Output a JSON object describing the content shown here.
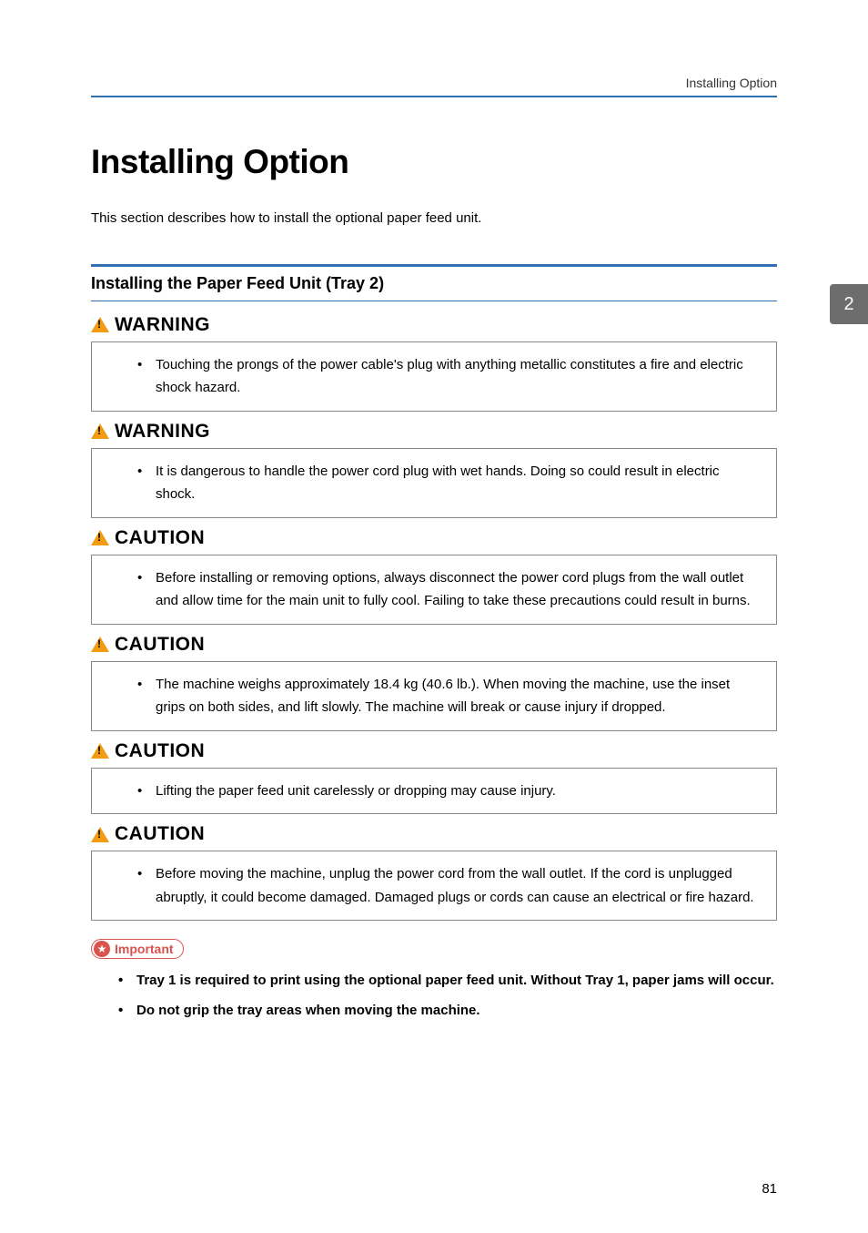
{
  "header": {
    "running_title": "Installing Option"
  },
  "section_tab": "2",
  "title": "Installing Option",
  "intro": "This section describes how to install the optional paper feed unit.",
  "subsection": "Installing the Paper Feed Unit (Tray 2)",
  "labels": {
    "warning": "WARNING",
    "caution": "CAUTION",
    "important": "Important"
  },
  "alerts": [
    {
      "level": "warning",
      "text": "Touching the prongs of the power cable's plug with anything metallic constitutes a fire and electric shock hazard."
    },
    {
      "level": "warning",
      "text": "It is dangerous to handle the power cord plug with wet hands. Doing so could result in electric shock."
    },
    {
      "level": "caution",
      "text": "Before installing or removing options, always disconnect the power cord plugs from the wall outlet and allow time for the main unit to fully cool. Failing to take these precautions could result in burns."
    },
    {
      "level": "caution",
      "text": "The machine weighs approximately 18.4 kg (40.6 lb.). When moving the machine, use the inset grips on both sides, and lift slowly. The machine will break or cause injury if dropped."
    },
    {
      "level": "caution",
      "text": "Lifting the paper feed unit carelessly or dropping may cause injury."
    },
    {
      "level": "caution",
      "text": "Before moving the machine, unplug the power cord from the wall outlet. If the cord is unplugged abruptly, it could become damaged. Damaged plugs or cords can cause an electrical or fire hazard."
    }
  ],
  "important_items": [
    "Tray 1 is required to print using the optional paper feed unit. Without Tray 1, paper jams will occur.",
    "Do not grip the tray areas when moving the machine."
  ],
  "page_number": "81"
}
